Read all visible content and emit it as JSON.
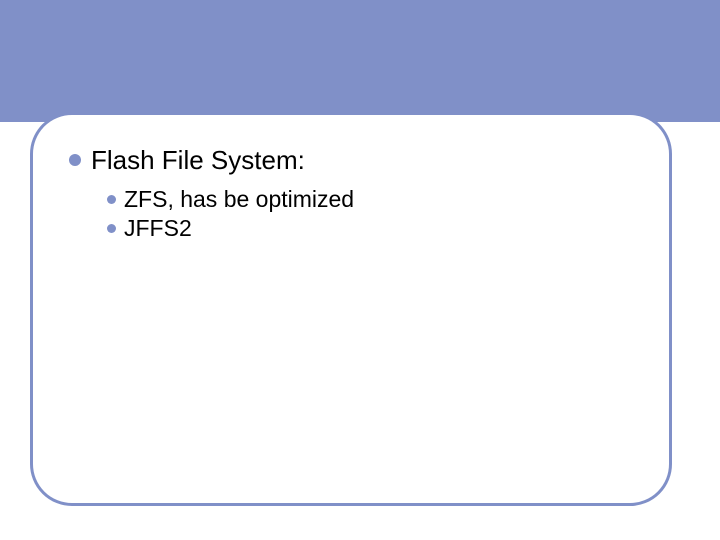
{
  "slide": {
    "heading": "Flash File System:",
    "items": [
      "ZFS, has be optimized",
      "JFFS2"
    ]
  },
  "colors": {
    "accent": "#8090c8"
  }
}
